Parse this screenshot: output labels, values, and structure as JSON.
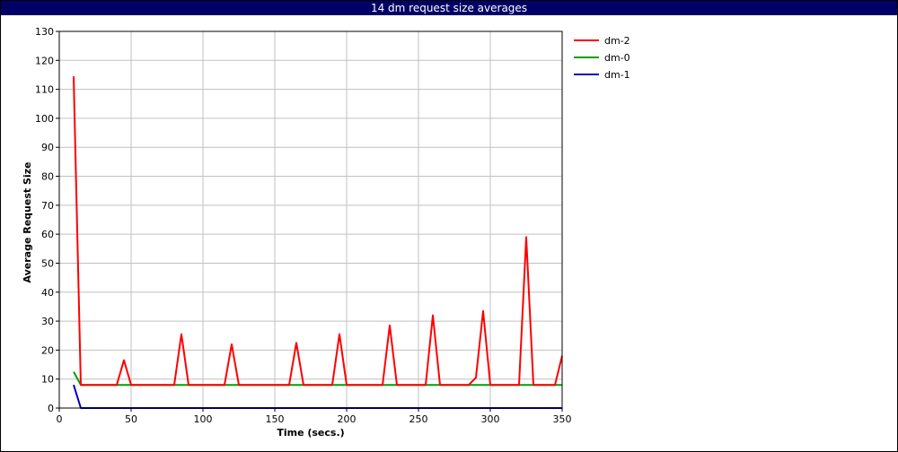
{
  "window": {
    "title": "14 dm request size averages"
  },
  "chart_data": {
    "type": "line",
    "title": "14 dm request size averages",
    "xlabel": "Time (secs.)",
    "ylabel": "Average Request Size",
    "xlim": [
      0,
      350
    ],
    "ylim": [
      0,
      130
    ],
    "xticks": [
      0,
      50,
      100,
      150,
      200,
      250,
      300,
      350
    ],
    "yticks": [
      0,
      10,
      20,
      30,
      40,
      50,
      60,
      70,
      80,
      90,
      100,
      110,
      120,
      130
    ],
    "grid": true,
    "legend_position": "right",
    "series": [
      {
        "name": "dm-2",
        "color": "#ff0000",
        "x": [
          10,
          15,
          20,
          25,
          30,
          35,
          40,
          45,
          50,
          55,
          60,
          65,
          70,
          75,
          80,
          85,
          90,
          95,
          100,
          105,
          110,
          115,
          120,
          125,
          130,
          135,
          140,
          145,
          150,
          155,
          160,
          165,
          170,
          175,
          180,
          185,
          190,
          195,
          200,
          205,
          210,
          215,
          220,
          225,
          230,
          235,
          240,
          245,
          250,
          255,
          260,
          265,
          270,
          275,
          280,
          285,
          290,
          295,
          300,
          305,
          310,
          315,
          320,
          325,
          330,
          335,
          340,
          345,
          350
        ],
        "y": [
          114.5,
          8,
          8,
          8,
          8,
          8,
          8,
          16.5,
          8,
          8,
          8,
          8,
          8,
          8,
          8,
          25.5,
          8,
          8,
          8,
          8,
          8,
          8,
          22,
          8,
          8,
          8,
          8,
          8,
          8,
          8,
          8,
          22.5,
          8,
          8,
          8,
          8,
          8,
          25.5,
          8,
          8,
          8,
          8,
          8,
          8,
          28.5,
          8,
          8,
          8,
          8,
          8,
          32,
          8,
          8,
          8,
          8,
          8,
          10.5,
          33.5,
          8,
          8,
          8,
          8,
          8,
          59,
          8,
          8,
          8,
          8,
          18
        ]
      },
      {
        "name": "dm-0",
        "color": "#00a000",
        "x": [
          10,
          15,
          350
        ],
        "y": [
          12.5,
          8,
          8
        ]
      },
      {
        "name": "dm-1",
        "color": "#0000c0",
        "x": [
          10,
          15,
          350
        ],
        "y": [
          8,
          0,
          0
        ]
      }
    ]
  }
}
